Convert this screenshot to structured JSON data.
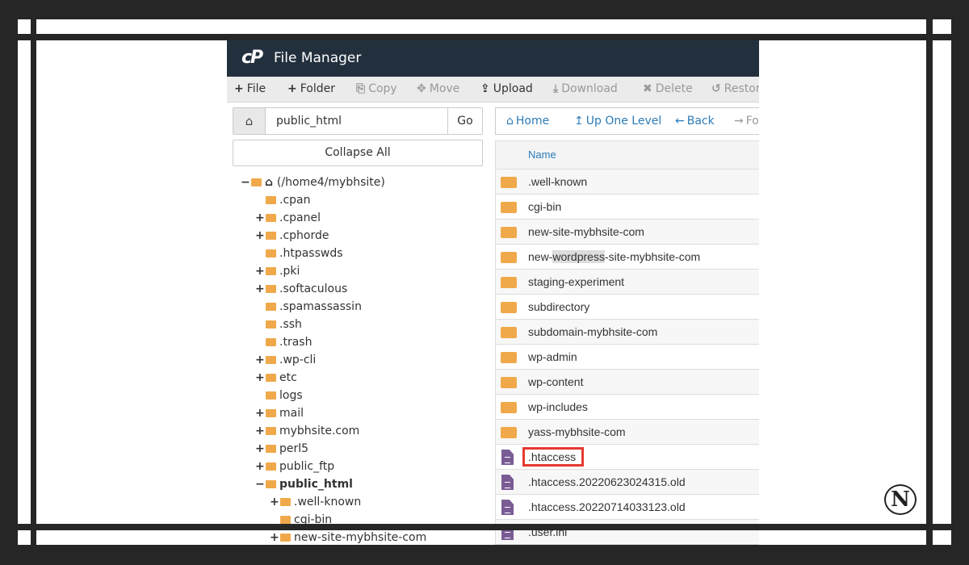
{
  "app": {
    "title": "File Manager",
    "logo": "cP"
  },
  "toolbar": [
    {
      "icon": "plus-icon",
      "glyph": "+",
      "label": "File",
      "enabled": true
    },
    {
      "icon": "plus-icon",
      "glyph": "+",
      "label": "Folder",
      "enabled": true
    },
    {
      "icon": "copy-icon",
      "glyph": "⎘",
      "label": "Copy",
      "enabled": false
    },
    {
      "icon": "move-icon",
      "glyph": "✥",
      "label": "Move",
      "enabled": false
    },
    {
      "icon": "upload-icon",
      "glyph": "⇪",
      "label": "Upload",
      "enabled": true
    },
    {
      "icon": "download-icon",
      "glyph": "⤓",
      "label": "Download",
      "enabled": false
    },
    {
      "icon": "delete-icon",
      "glyph": "✖",
      "label": "Delete",
      "enabled": false
    },
    {
      "icon": "restore-icon",
      "glyph": "↺",
      "label": "Restore",
      "enabled": false
    }
  ],
  "path": {
    "value": "public_html",
    "go": "Go",
    "collapse_all": "Collapse All"
  },
  "tree": [
    {
      "label": "(/home4/mybhsite)",
      "level": 0,
      "toggle": "−",
      "open": true,
      "home": true
    },
    {
      "label": ".cpan",
      "level": 1,
      "toggle": ""
    },
    {
      "label": ".cpanel",
      "level": 1,
      "toggle": "+"
    },
    {
      "label": ".cphorde",
      "level": 1,
      "toggle": "+"
    },
    {
      "label": ".htpasswds",
      "level": 1,
      "toggle": ""
    },
    {
      "label": ".pki",
      "level": 1,
      "toggle": "+"
    },
    {
      "label": ".softaculous",
      "level": 1,
      "toggle": "+"
    },
    {
      "label": ".spamassassin",
      "level": 1,
      "toggle": ""
    },
    {
      "label": ".ssh",
      "level": 1,
      "toggle": ""
    },
    {
      "label": ".trash",
      "level": 1,
      "toggle": ""
    },
    {
      "label": ".wp-cli",
      "level": 1,
      "toggle": "+"
    },
    {
      "label": "etc",
      "level": 1,
      "toggle": "+"
    },
    {
      "label": "logs",
      "level": 1,
      "toggle": ""
    },
    {
      "label": "mail",
      "level": 1,
      "toggle": "+"
    },
    {
      "label": "mybhsite.com",
      "level": 1,
      "toggle": "+"
    },
    {
      "label": "perl5",
      "level": 1,
      "toggle": "+"
    },
    {
      "label": "public_ftp",
      "level": 1,
      "toggle": "+"
    },
    {
      "label": "public_html",
      "level": 1,
      "toggle": "−",
      "open": true,
      "bold": true
    },
    {
      "label": ".well-known",
      "level": 2,
      "toggle": "+"
    },
    {
      "label": "cgi-bin",
      "level": 2,
      "toggle": ""
    },
    {
      "label": "new-site-mybhsite-com",
      "level": 2,
      "toggle": "+"
    }
  ],
  "nav": [
    {
      "icon": "home-icon",
      "glyph": "⌂",
      "label": "Home",
      "enabled": true
    },
    {
      "icon": "up-level-icon",
      "glyph": "↥",
      "label": "Up One Level",
      "enabled": true
    },
    {
      "icon": "back-icon",
      "glyph": "←",
      "label": "Back",
      "enabled": true
    },
    {
      "icon": "forward-icon",
      "glyph": "→",
      "label": "Forward",
      "enabled": false
    }
  ],
  "table": {
    "header": "Name",
    "rows": [
      {
        "type": "folder",
        "name": ".well-known"
      },
      {
        "type": "folder",
        "name": "cgi-bin"
      },
      {
        "type": "folder",
        "name": "new-site-mybhsite-com"
      },
      {
        "type": "folder",
        "name": "new-wordpress-site-mybhsite-com",
        "parts": [
          "new-",
          "wordpress",
          "-site-mybhsite-com"
        ]
      },
      {
        "type": "folder",
        "name": "staging-experiment"
      },
      {
        "type": "folder",
        "name": "subdirectory"
      },
      {
        "type": "folder",
        "name": "subdomain-mybhsite-com"
      },
      {
        "type": "folder",
        "name": "wp-admin"
      },
      {
        "type": "folder",
        "name": "wp-content"
      },
      {
        "type": "folder",
        "name": "wp-includes"
      },
      {
        "type": "folder",
        "name": "yass-mybhsite-com"
      },
      {
        "type": "file",
        "name": ".htaccess",
        "highlighted": true
      },
      {
        "type": "file",
        "name": ".htaccess.20220623024315.old"
      },
      {
        "type": "file",
        "name": ".htaccess.20220714033123.old"
      },
      {
        "type": "file",
        "name": ".user.ini"
      }
    ]
  },
  "colors": {
    "header_bg": "#22303e",
    "link": "#2b7bb9",
    "folder": "#f0a94a",
    "file": "#7a5c95",
    "highlight_box": "#e53a2f"
  },
  "watermark": "N"
}
